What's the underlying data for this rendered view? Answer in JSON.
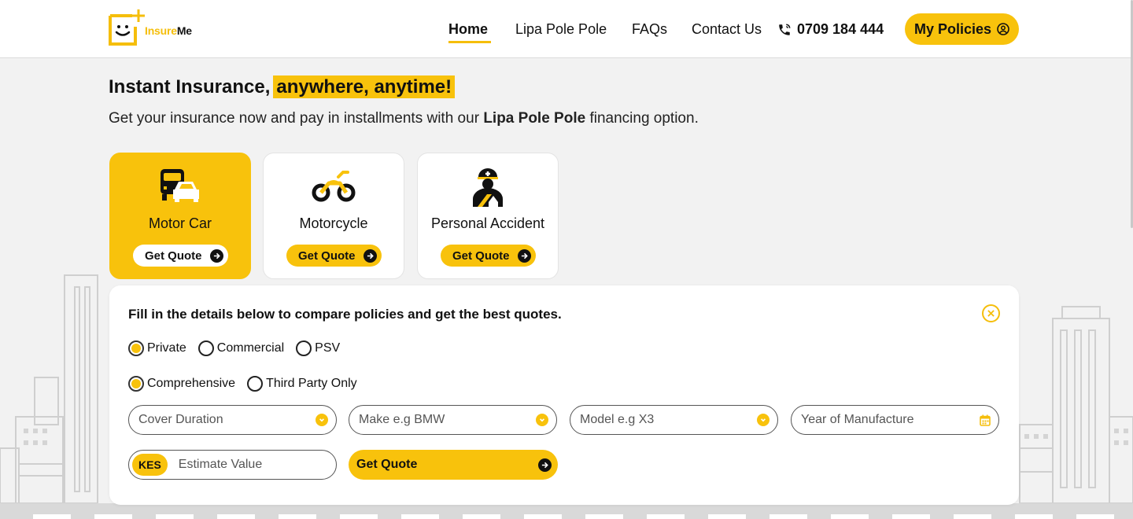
{
  "header": {
    "logo": {
      "word1": "Insure",
      "word2": "Me"
    },
    "nav": [
      {
        "label": "Home",
        "active": true
      },
      {
        "label": "Lipa Pole Pole",
        "active": false
      },
      {
        "label": "FAQs",
        "active": false
      },
      {
        "label": "Contact Us",
        "active": false
      }
    ],
    "phone": "0709 184 444",
    "policies_button": "My Policies"
  },
  "hero": {
    "title_plain": "Instant Insurance,",
    "title_highlight": "anywhere, anytime!",
    "subtitle_pre": "Get your insurance now and pay in installments with our",
    "subtitle_bold": "Lipa Pole Pole",
    "subtitle_post": "financing option."
  },
  "products": [
    {
      "label": "Motor Car",
      "icon": "motor-car-icon",
      "button": "Get Quote",
      "selected": true
    },
    {
      "label": "Motorcycle",
      "icon": "motorcycle-icon",
      "button": "Get Quote",
      "selected": false
    },
    {
      "label": "Personal Accident",
      "icon": "personal-accident-icon",
      "button": "Get Quote",
      "selected": false
    }
  ],
  "form": {
    "title": "Fill in the details below to compare policies and get the best quotes.",
    "usage_options": [
      {
        "label": "Private",
        "checked": true
      },
      {
        "label": "Commercial",
        "checked": false
      },
      {
        "label": "PSV",
        "checked": false
      }
    ],
    "cover_options": [
      {
        "label": "Comprehensive",
        "checked": true
      },
      {
        "label": "Third Party Only",
        "checked": false
      }
    ],
    "fields": {
      "cover_duration": "Cover Duration",
      "make": "Make e.g BMW",
      "model": "Model e.g X3",
      "year": "Year of Manufacture"
    },
    "currency": "KES",
    "estimate_placeholder": "Estimate Value",
    "submit": "Get Quote"
  },
  "colors": {
    "accent": "#f8c20c",
    "text": "#111111",
    "background": "#f2f2f2"
  }
}
